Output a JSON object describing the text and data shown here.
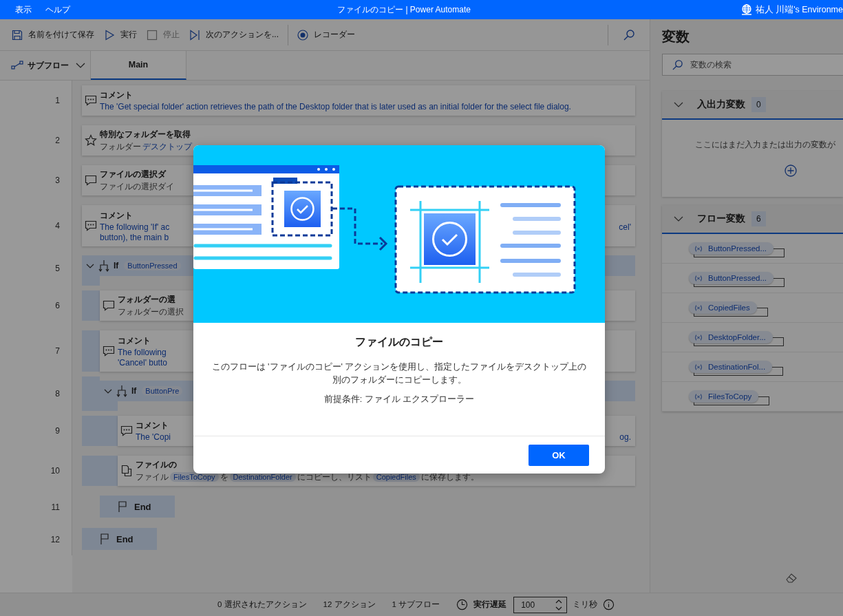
{
  "window": {
    "title": "ファイルのコピー | Power Automate",
    "menu": [
      "表示",
      "ヘルプ"
    ],
    "account": "祐人 川端's Environme"
  },
  "toolbar": [
    {
      "label": "名前を付けて保存",
      "kind": "save",
      "disabled": false
    },
    {
      "label": "実行",
      "kind": "run",
      "disabled": false
    },
    {
      "label": "停止",
      "kind": "stop",
      "disabled": true
    },
    {
      "label": "次のアクションを...",
      "kind": "next",
      "disabled": false
    },
    {
      "label": "レコーダー",
      "kind": "recorder",
      "disabled": false
    }
  ],
  "subflow_menu": {
    "label": "サブフロー"
  },
  "tabs": [
    {
      "label": "Main",
      "selected": true
    }
  ],
  "steps": [
    {
      "line": "1",
      "kind": "comment",
      "title": "コメント",
      "lines": [
        {
          "parts": [
            {
              "kind": "link",
              "text": "The 'Get special folder' action retrieves the path of the Desktop folder that is later used as an initial folder for the select file dialog."
            }
          ]
        }
      ]
    },
    {
      "line": "2",
      "kind": "special-folder",
      "title": "特別なフォルダーを取得",
      "lines": [
        {
          "parts": [
            {
              "kind": "text",
              "text": "フォルダー"
            },
            {
              "kind": "link",
              "text": "デスクトップ"
            }
          ]
        }
      ]
    },
    {
      "line": "3",
      "kind": "dialog",
      "title": "ファイルの選択ダ",
      "lines": [
        {
          "parts": [
            {
              "kind": "text",
              "text": "ファイルの選択ダイ"
            }
          ]
        }
      ]
    },
    {
      "line": "4",
      "kind": "comment",
      "title": "コメント",
      "lines": [
        {
          "parts": [
            {
              "kind": "link",
              "text": "The following 'If' ac"
            }
          ],
          "tail": "cel'"
        },
        {
          "parts": [
            {
              "kind": "link",
              "text": "button), the main b"
            }
          ]
        }
      ]
    },
    {
      "line": "5",
      "kind": "if",
      "keyword": "If",
      "condition": "ButtonPressed",
      "expanded": true,
      "end": {
        "line": "12",
        "label": "End"
      },
      "children": [
        {
          "line": "6",
          "kind": "dialog",
          "title": "フォルダーの選",
          "lines": [
            {
              "parts": [
                {
                  "kind": "text",
                  "text": "フォルダーの選択"
                }
              ]
            }
          ]
        },
        {
          "line": "7",
          "kind": "comment",
          "title": "コメント",
          "lines": [
            {
              "parts": [
                {
                  "kind": "link",
                  "text": "The following"
                }
              ]
            },
            {
              "parts": [
                {
                  "kind": "link",
                  "text": "'Cancel' butto"
                }
              ]
            }
          ]
        },
        {
          "line": "8",
          "kind": "if",
          "keyword": "If",
          "condition": "ButtonPre",
          "expanded": true,
          "end": {
            "line": "11",
            "label": "End"
          },
          "children": [
            {
              "line": "9",
              "kind": "comment",
              "title": "コメント",
              "lines": [
                {
                  "parts": [
                    {
                      "kind": "link",
                      "text": "The 'Copi"
                    }
                  ],
                  "tail": "og."
                }
              ]
            },
            {
              "line": "10",
              "kind": "copy",
              "title": "ファイルの",
              "lines": [
                {
                  "parts": [
                    {
                      "kind": "text",
                      "text": "ファイル"
                    },
                    {
                      "kind": "var",
                      "text": "FilesToCopy"
                    },
                    {
                      "kind": "text",
                      "text": "を"
                    },
                    {
                      "kind": "var",
                      "text": "DestinationFolder"
                    },
                    {
                      "kind": "text",
                      "text": "にコピーし、リスト"
                    },
                    {
                      "kind": "var",
                      "text": "CopiedFiles"
                    },
                    {
                      "kind": "text",
                      "text": "に保存します。"
                    }
                  ]
                }
              ]
            }
          ]
        }
      ]
    }
  ],
  "variables_panel": {
    "title": "変数",
    "search": {
      "placeholder": "変数の検索"
    },
    "sections": [
      {
        "title": "入出力変数",
        "count": "0",
        "expanded": true,
        "empty_text": "ここにはまだ入力または出力の変数が"
      },
      {
        "title": "フロー変数",
        "count": "6",
        "expanded": true,
        "variables": [
          "ButtonPressed...",
          "ButtonPressed...",
          "CopiedFiles",
          "DesktopFolder...",
          "DestinationFol...",
          "FilesToCopy"
        ]
      }
    ]
  },
  "status_bar": {
    "selected": "0 選択されたアクション",
    "actions": "12 アクション",
    "subflows": "1 サブフロー",
    "delay_label": "実行遅延",
    "delay_value": "100",
    "unit": "ミリ秒"
  },
  "dialog": {
    "title": "ファイルのコピー",
    "body": "このフローは 'ファイルのコピー' アクションを使用し、指定したファイルをデスクトップ上の別のフォルダーにコピーします。",
    "prerequisite": "前提条件: ファイル エクスプローラー",
    "button": "OK"
  }
}
